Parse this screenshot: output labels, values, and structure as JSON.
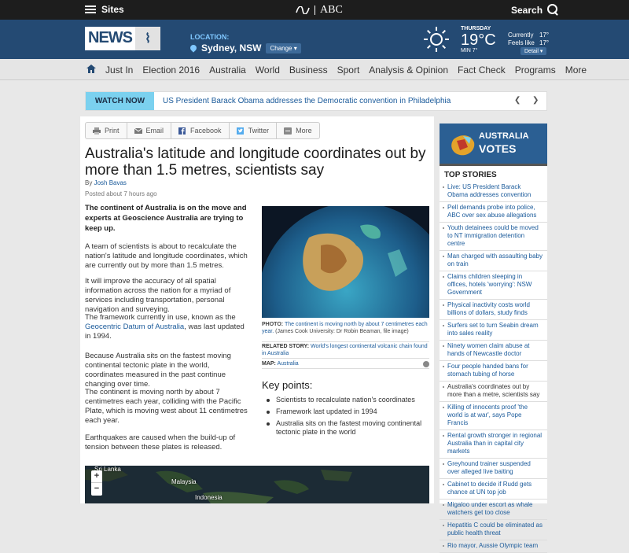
{
  "topbar": {
    "sites": "Sites",
    "abc": "ABC",
    "search": "Search"
  },
  "header": {
    "logo": "NEWS",
    "location_label": "LOCATION:",
    "location": "Sydney, NSW",
    "change": "Change",
    "weather": {
      "day": "THURSDAY",
      "temp": "19°C",
      "min": "MIN 7°",
      "currently_label": "Currently",
      "feels_label": "Feels like",
      "currently": "17°",
      "feels": "17°",
      "detail": "Detail"
    }
  },
  "nav": {
    "items": [
      "Just In",
      "Election 2016",
      "Australia",
      "World",
      "Business",
      "Sport",
      "Analysis & Opinion",
      "Fact Check",
      "Programs",
      "More"
    ]
  },
  "watch": {
    "label": "WATCH NOW",
    "text": "US President Barack Obama addresses the Democratic convention in Philadelphia"
  },
  "share": {
    "print": "Print",
    "email": "Email",
    "facebook": "Facebook",
    "twitter": "Twitter",
    "more": "More"
  },
  "article": {
    "title": "Australia's latitude and longitude coordinates out by more than 1.5 metres, scientists say",
    "byline_prefix": "By",
    "author": "Josh Bavas",
    "posted": "Posted about 7 hours ago",
    "intro": "The continent of Australia is on the move and experts at Geoscience Australia are trying to keep up.",
    "p1": "A team of scientists is about to recalculate the nation's latitude and longitude coordinates, which are currently out by more than 1.5 metres.",
    "p2": "It will improve the accuracy of all spatial information across the nation for a myriad of services including transportation, personal navigation and surveying.",
    "p3_a": "The framework currently in use, known as the",
    "p3_link": "Geocentric Datum of Australia",
    "p3_b": ", was last updated in 1994.",
    "p4": "Because Australia sits on the fastest moving continental tectonic plate in the world, coordinates measured in the past continue changing over time.",
    "p5": "The continent is moving north by about 7 centimetres each year, colliding with the Pacific Plate, which is moving west about 11 centimetres each year.",
    "p6": "Earthquakes are caused when the build-up of tension between these plates is released.",
    "photo_label": "PHOTO:",
    "photo_caption": "The continent is moving north by about 7 centimetres each year.",
    "photo_credit": "(James Cook University: Dr Robin Beaman, file image)",
    "related_label": "RELATED STORY:",
    "related": "World's longest continental volcanic chain found in Australia",
    "map_label": "MAP:",
    "map": "Australia",
    "keypoints_title": "Key points:",
    "keypoints": [
      "Scientists to recalculate nation's coordinates",
      "Framework last updated in 1994",
      "Australia sits on the fastest moving continental tectonic plate in the world"
    ],
    "map_labels": {
      "srilanka": "Sri Lanka",
      "malaysia": "Malaysia",
      "indonesia": "Indonesia"
    },
    "zoom_in": "+",
    "zoom_out": "−"
  },
  "sidebar": {
    "votes_line1": "AUSTRALIA",
    "votes_line2": "VOTES",
    "top_stories_title": "TOP STORIES",
    "stories": [
      "Live: US President Barack Obama addresses convention",
      "Pell demands probe into police, ABC over sex abuse allegations",
      "Youth detainees could be moved to NT immigration detention centre",
      "Man charged with assaulting baby on train",
      "Claims children sleeping in offices, hotels 'worrying': NSW Government",
      "Physical inactivity costs world billions of dollars, study finds",
      "Surfers set to turn Seabin dream into sales reality",
      "Ninety women claim abuse at hands of Newcastle doctor",
      "Four people handed bans for stomach tubing of horse",
      "Australia's coordinates out by more than a metre, scientists say",
      "Killing of innocents proof 'the world is at war', says Pope Francis",
      "Rental growth stronger in regional Australia than in capital city markets",
      "Greyhound trainer suspended over alleged live baiting",
      "Cabinet to decide if Rudd gets chance at UN top job",
      "Migaloo under escort as whale watchers get too close",
      "Hepatitis C could be eliminated as public health threat",
      "Rio mayor, Aussie Olympic team"
    ]
  },
  "colors": {
    "header": "#244a73",
    "topbar": "#1d1d1d",
    "accent": "#7bd1ef",
    "link": "#1a5a9a"
  }
}
